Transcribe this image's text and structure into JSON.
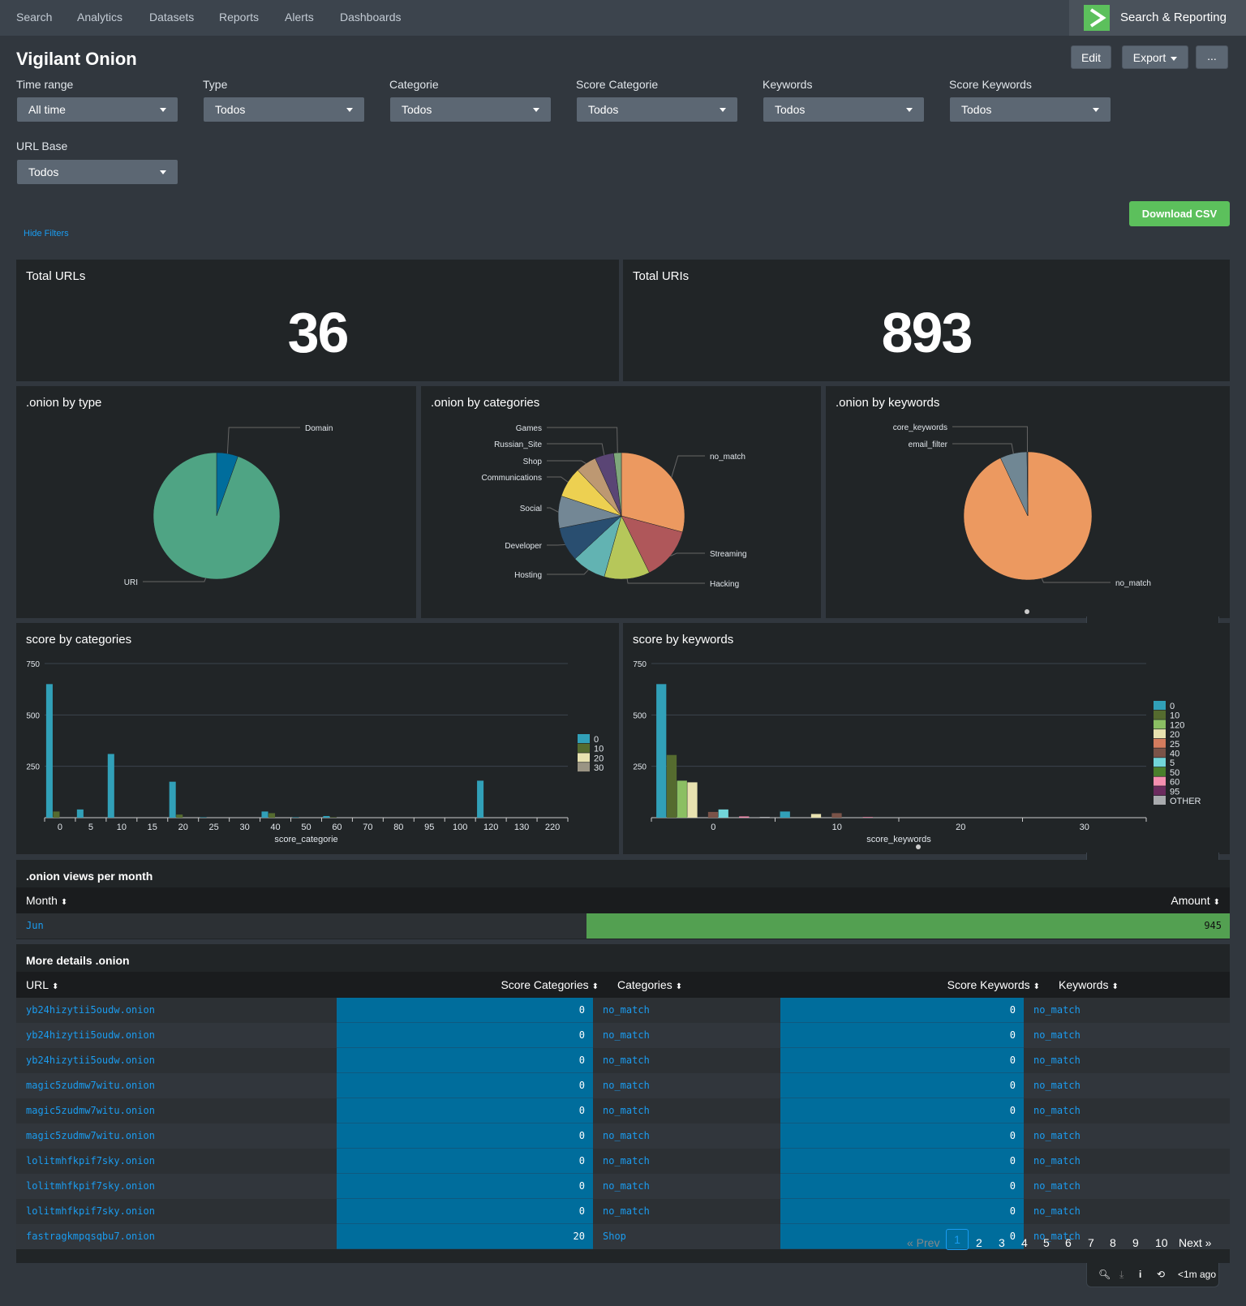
{
  "topnav": {
    "items": [
      "Search",
      "Analytics",
      "Datasets",
      "Reports",
      "Alerts",
      "Dashboards"
    ],
    "app_name": "Search & Reporting",
    "app_logo_color": "#5cc05c"
  },
  "dashboard": {
    "title": "Vigilant Onion",
    "edit_label": "Edit",
    "export_label": "Export",
    "more_label": "...",
    "download_label": "Download CSV",
    "hide_filters_label": "Hide Filters"
  },
  "filters": [
    {
      "label": "Time range",
      "value": "All time"
    },
    {
      "label": "Type",
      "value": "Todos"
    },
    {
      "label": "Categorie",
      "value": "Todos"
    },
    {
      "label": "Score Categorie",
      "value": "Todos"
    },
    {
      "label": "Keywords",
      "value": "Todos"
    },
    {
      "label": "Score Keywords",
      "value": "Todos"
    },
    {
      "label": "URL Base",
      "value": "Todos"
    }
  ],
  "singles": [
    {
      "title": "Total URLs",
      "value": "36"
    },
    {
      "title": "Total URIs",
      "value": "893"
    }
  ],
  "panel_toolbar": {
    "time_label": "<1m ago"
  },
  "chart_data": [
    {
      "type": "pie",
      "title": ".onion by type",
      "labels": [
        "Domain",
        "URI"
      ],
      "values": [
        5.5,
        94.5
      ],
      "colors": [
        "#006d9c",
        "#4fa484"
      ]
    },
    {
      "type": "pie",
      "title": ".onion by categories",
      "labels": [
        "no_match",
        "Streaming",
        "Hacking",
        "Hosting",
        "Developer",
        "Social",
        "Communications",
        "Shop",
        "Russian_Site",
        "Games"
      ],
      "values": [
        30,
        14,
        12,
        9,
        9,
        8.5,
        8,
        5.5,
        5,
        2
      ],
      "colors": [
        "#ec9960",
        "#af575a",
        "#b6c75a",
        "#62b3b2",
        "#294e70",
        "#738795",
        "#edd051",
        "#bd9872",
        "#5a4575",
        "#7ea77b"
      ]
    },
    {
      "type": "pie",
      "title": ".onion by keywords",
      "labels": [
        "no_match",
        "email_filter",
        "core_keywords"
      ],
      "values": [
        93,
        6.8,
        0.2
      ],
      "colors": [
        "#ec9960",
        "#708794",
        "#294e70"
      ]
    },
    {
      "type": "bar",
      "title": "score by categories",
      "xlabel": "score_categorie",
      "ylabel": "",
      "ylim": [
        0,
        750
      ],
      "yticks": [
        250,
        500,
        750
      ],
      "categories": [
        "0",
        "5",
        "10",
        "15",
        "20",
        "25",
        "30",
        "40",
        "50",
        "60",
        "70",
        "80",
        "95",
        "100",
        "120",
        "130",
        "220"
      ],
      "series": [
        {
          "name": "0",
          "color": "#31a0b8",
          "values": [
            650,
            40,
            310,
            0,
            175,
            2,
            0,
            30,
            2,
            8,
            0,
            0,
            0,
            0,
            180,
            0,
            0
          ]
        },
        {
          "name": "10",
          "color": "#556b2f",
          "values": [
            30,
            0,
            0,
            0,
            15,
            0,
            0,
            22,
            0,
            2,
            0,
            0,
            0,
            0,
            0,
            0,
            0
          ]
        },
        {
          "name": "20",
          "color": "#e8e2b0",
          "values": [
            0,
            0,
            0,
            0,
            0,
            0,
            0,
            0,
            0,
            0,
            0,
            0,
            0,
            0,
            0,
            0,
            0
          ]
        },
        {
          "name": "30",
          "color": "#9a9484",
          "values": [
            0,
            0,
            0,
            0,
            0,
            0,
            0,
            0,
            0,
            0,
            0,
            0,
            0,
            0,
            0,
            0,
            0
          ]
        }
      ],
      "legend": "right"
    },
    {
      "type": "bar",
      "title": "score by keywords",
      "xlabel": "score_keywords",
      "ylabel": "",
      "ylim": [
        0,
        750
      ],
      "yticks": [
        250,
        500,
        750
      ],
      "xticks": [
        "0",
        "10",
        "20",
        "30"
      ],
      "categories": [
        "0",
        "10",
        "20",
        "30"
      ],
      "series": [
        {
          "name": "0",
          "color": "#31a0b8",
          "values": [
            650,
            30,
            0,
            0
          ]
        },
        {
          "name": "10",
          "color": "#556b2f",
          "values": [
            305,
            0,
            0,
            0
          ]
        },
        {
          "name": "120",
          "color": "#8bbf63",
          "values": [
            180,
            0,
            0,
            0
          ]
        },
        {
          "name": "20",
          "color": "#e8e2b0",
          "values": [
            172,
            18,
            0,
            0
          ]
        },
        {
          "name": "25",
          "color": "#d47c5e",
          "values": [
            0,
            0,
            0,
            0
          ]
        },
        {
          "name": "40",
          "color": "#7a5348",
          "values": [
            28,
            22,
            0,
            0
          ]
        },
        {
          "name": "5",
          "color": "#72d5d9",
          "values": [
            40,
            0,
            0,
            0
          ]
        },
        {
          "name": "50",
          "color": "#4a7f2c",
          "values": [
            0,
            0,
            0,
            0
          ]
        },
        {
          "name": "60",
          "color": "#f58fb0",
          "values": [
            6,
            3,
            0,
            0
          ]
        },
        {
          "name": "95",
          "color": "#6b2b5e",
          "values": [
            0,
            0,
            0,
            0
          ]
        },
        {
          "name": "OTHER",
          "color": "#a9abae",
          "values": [
            4,
            0,
            0,
            0
          ]
        }
      ],
      "legend": "right"
    }
  ],
  "views_table": {
    "title": ".onion views per month",
    "columns": [
      "Month",
      "Amount"
    ],
    "rows": [
      {
        "month": "Jun",
        "amount": "945",
        "fraction": 0.53
      }
    ],
    "bar_color": "#53a051"
  },
  "details_table": {
    "title": "More details .onion",
    "columns": [
      "URL",
      "Score Categories",
      "Categories",
      "Score Keywords",
      "Keywords"
    ],
    "rows": [
      [
        "yb24hizytii5oudw.onion",
        "0",
        "no_match",
        "0",
        "no_match"
      ],
      [
        "yb24hizytii5oudw.onion",
        "0",
        "no_match",
        "0",
        "no_match"
      ],
      [
        "yb24hizytii5oudw.onion",
        "0",
        "no_match",
        "0",
        "no_match"
      ],
      [
        "magic5zudmw7witu.onion",
        "0",
        "no_match",
        "0",
        "no_match"
      ],
      [
        "magic5zudmw7witu.onion",
        "0",
        "no_match",
        "0",
        "no_match"
      ],
      [
        "magic5zudmw7witu.onion",
        "0",
        "no_match",
        "0",
        "no_match"
      ],
      [
        "lolitmhfkpif7sky.onion",
        "0",
        "no_match",
        "0",
        "no_match"
      ],
      [
        "lolitmhfkpif7sky.onion",
        "0",
        "no_match",
        "0",
        "no_match"
      ],
      [
        "lolitmhfkpif7sky.onion",
        "0",
        "no_match",
        "0",
        "no_match"
      ],
      [
        "fastragkmpqsqbu7.onion",
        "20",
        "Shop",
        "0",
        "no_match"
      ]
    ],
    "score_cell_color": "#006d9c",
    "pagination": {
      "prev": "« Prev",
      "pages": [
        "1",
        "2",
        "3",
        "4",
        "5",
        "6",
        "7",
        "8",
        "9",
        "10"
      ],
      "current": "1",
      "next": "Next »"
    }
  }
}
